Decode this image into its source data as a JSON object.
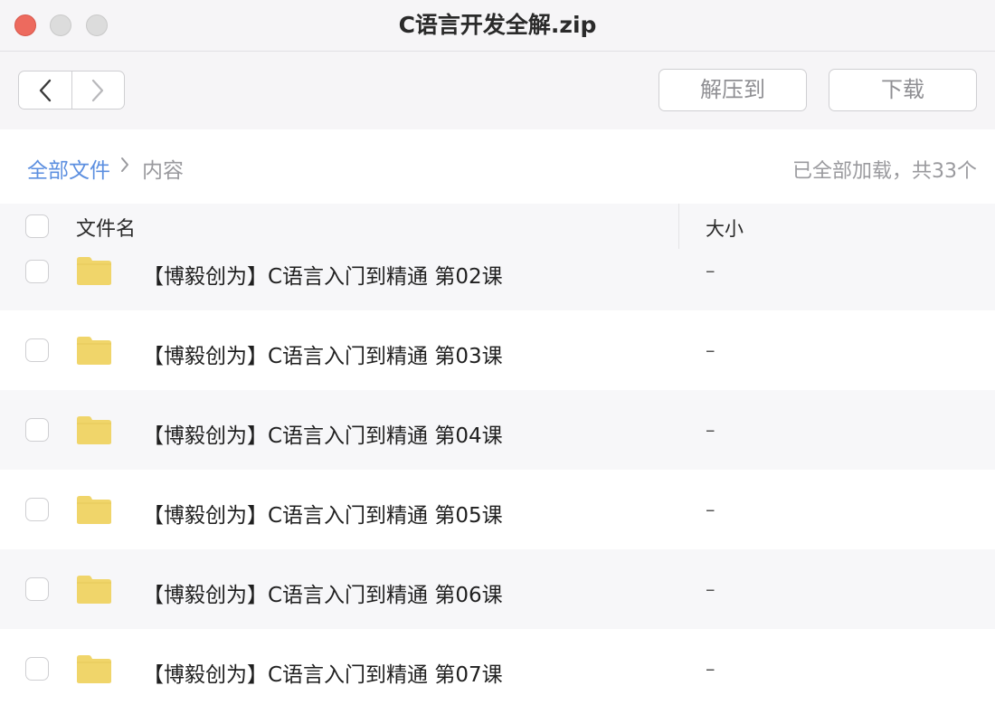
{
  "window": {
    "title": "C语言开发全解.zip"
  },
  "toolbar": {
    "back_icon": "chevron-left-icon",
    "forward_icon": "chevron-right-icon",
    "extract_label": "解压到",
    "download_label": "下载"
  },
  "breadcrumb": {
    "root_label": "全部文件",
    "separator_icon": "chevron-right-icon",
    "current_label": "内容",
    "status": "已全部加载，共33个"
  },
  "table": {
    "columns": {
      "name": "文件名",
      "size": "大小"
    },
    "rows": [
      {
        "name": "【博毅创为】C语言入门到精通 第02课",
        "size": "–",
        "icon": "folder-icon"
      },
      {
        "name": "【博毅创为】C语言入门到精通 第03课",
        "size": "–",
        "icon": "folder-icon"
      },
      {
        "name": "【博毅创为】C语言入门到精通 第04课",
        "size": "–",
        "icon": "folder-icon"
      },
      {
        "name": "【博毅创为】C语言入门到精通 第05课",
        "size": "–",
        "icon": "folder-icon"
      },
      {
        "name": "【博毅创为】C语言入门到精通 第06课",
        "size": "–",
        "icon": "folder-icon"
      },
      {
        "name": "【博毅创为】C语言入门到精通 第07课",
        "size": "–",
        "icon": "folder-icon"
      }
    ]
  },
  "colors": {
    "accent_link": "#5c8fe0",
    "folder": "#f0d56a",
    "close_button": "#ed6a5e"
  }
}
